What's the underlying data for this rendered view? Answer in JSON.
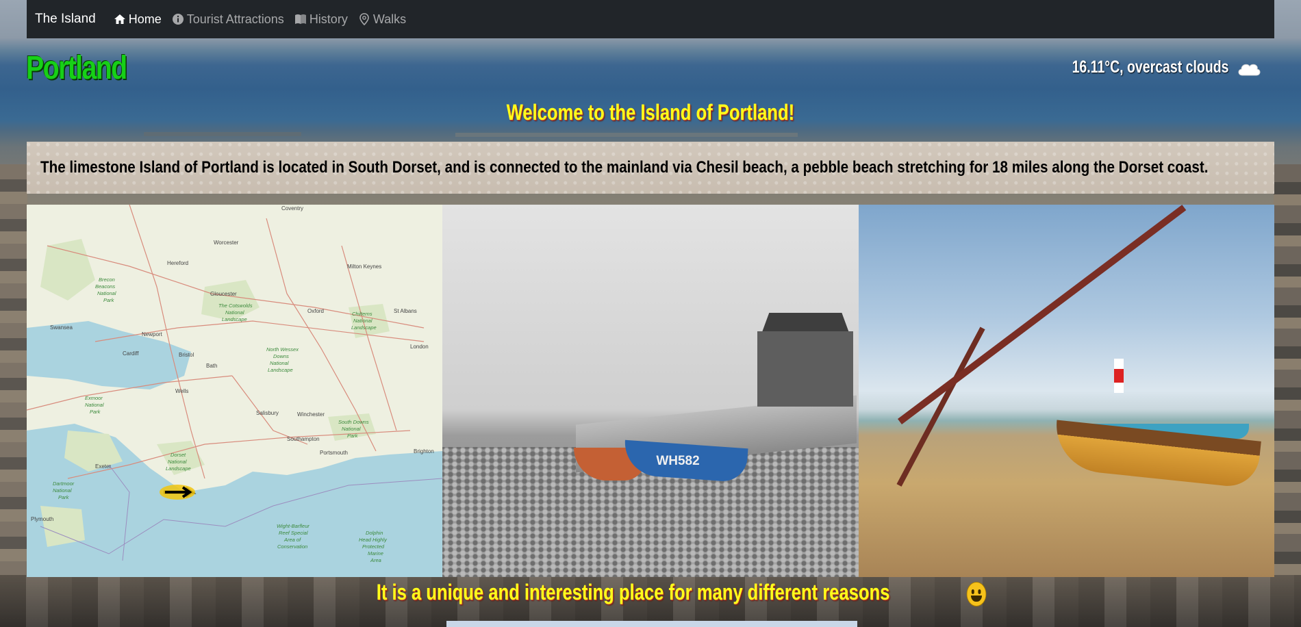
{
  "nav": {
    "brand": "The Island",
    "items": [
      {
        "label": "Home",
        "icon": "home-icon",
        "active": true
      },
      {
        "label": "Tourist Attractions",
        "icon": "info-icon",
        "active": false
      },
      {
        "label": "History",
        "icon": "book-icon",
        "active": false
      },
      {
        "label": "Walks",
        "icon": "location-pin-icon",
        "active": false
      }
    ]
  },
  "header": {
    "title": "Portland",
    "weather": "16.11°C, overcast clouds",
    "weather_icon": "cloud-icon"
  },
  "welcome": "Welcome to the Island of Portland!",
  "intro": "The limestone Island of Portland is located in South Dorset, and is connected to the mainland via Chesil beach, a pebble beach stretching for 18 miles along the Dorset coast.",
  "gallery": {
    "map_labels": [
      "Coventry",
      "Worcester",
      "Hereford",
      "Milton Keynes",
      "Gloucester",
      "Oxford",
      "St Albans",
      "Brecon Beacons National Park",
      "The Cotswolds National Landscape",
      "Chilterns National Landscape",
      "Swansea",
      "Newport",
      "Cardiff",
      "Bristol",
      "London",
      "Bath",
      "North Wessex Downs National Landscape",
      "Wells",
      "Exmoor National Park",
      "Salisbury",
      "Winchester",
      "South Downs National Park",
      "Southampton",
      "Portsmouth",
      "Brighton",
      "Dorset National Landscape",
      "Exeter",
      "Dartmoor National Park",
      "Plymouth",
      "Wight-Barfleur Reef Special Area of Conservation",
      "Dolphin Head Highly Protected Marine Area"
    ],
    "boat_registration": "WH582"
  },
  "tagline": "It is a unique and interesting place for many different reasons",
  "colors": {
    "nav_bg": "#212529",
    "title_green": "#17d017",
    "heading_yellow": "#ffff1a",
    "intro_bg": "#d2c8bc"
  }
}
